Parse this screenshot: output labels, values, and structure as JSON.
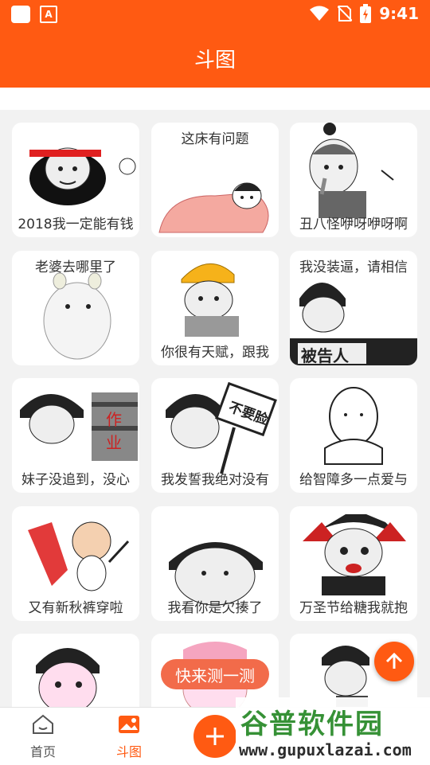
{
  "status_bar": {
    "time": "9:41"
  },
  "app_bar": {
    "title": "斗图"
  },
  "cards": [
    {
      "caption": "2018我一定能有钱",
      "caption_pos": "bottom"
    },
    {
      "caption": "这床有问题",
      "caption_pos": "top"
    },
    {
      "caption": "丑八怪咿呀咿呀啊",
      "caption_pos": "bottom"
    },
    {
      "caption": "老婆去哪里了",
      "caption_pos": "top"
    },
    {
      "caption": "你很有天赋，跟我",
      "caption_pos": "bottom"
    },
    {
      "caption": "我没装逼，请相信",
      "caption_pos": "top",
      "sign_text": "被告人"
    },
    {
      "caption": "妹子没追到，没心",
      "caption_pos": "bottom",
      "sign_text": "作业"
    },
    {
      "caption": "我发誓我绝对没有",
      "caption_pos": "bottom",
      "sign_text": "不要脸"
    },
    {
      "caption": "给智障多一点爱与",
      "caption_pos": "bottom"
    },
    {
      "caption": "又有新秋裤穿啦",
      "caption_pos": "bottom"
    },
    {
      "caption": "我看你是欠揍了",
      "caption_pos": "bottom"
    },
    {
      "caption": "万圣节给糖我就抱",
      "caption_pos": "bottom"
    },
    {
      "caption": "",
      "caption_pos": "bottom"
    },
    {
      "caption": "",
      "caption_pos": "bottom"
    },
    {
      "caption": "",
      "caption_pos": "bottom"
    }
  ],
  "floating_pill": {
    "label": "快来测一测"
  },
  "tab_bar": {
    "home_label": "首页",
    "doutu_label": "斗图",
    "active": "斗图"
  },
  "watermark": {
    "brand": "谷普软件园",
    "url": "www.gupuxlazai.com"
  },
  "colors": {
    "accent": "#ff5a12",
    "pill": "#f26b4a",
    "text": "#333333",
    "inactive_tab": "#555555"
  },
  "icons": [
    "wifi-icon",
    "no-sim-icon",
    "battery-icon",
    "home-icon",
    "image-icon",
    "plus-icon",
    "arrow-up-icon"
  ]
}
